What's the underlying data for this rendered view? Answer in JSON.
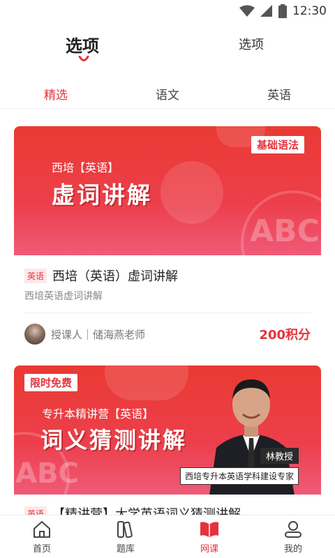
{
  "status_bar": {
    "time": "12:30"
  },
  "top_tabs": [
    {
      "label": "选项",
      "active": true
    },
    {
      "label": "选项",
      "active": false
    }
  ],
  "category_tabs": [
    {
      "label": "精选",
      "active": true
    },
    {
      "label": "语文",
      "active": false
    },
    {
      "label": "英语",
      "active": false
    }
  ],
  "courses": [
    {
      "banner": {
        "tag": "基础语法",
        "subtitle": "西培【英语】",
        "title": "虚词讲解",
        "watermark": "ABC"
      },
      "subject": "英语",
      "title": "西培（英语）虚词讲解",
      "description": "西培英语虚词讲解",
      "teacher": "授课人｜储海燕老师",
      "price": "200积分"
    },
    {
      "banner": {
        "tag": "限时免费",
        "subtitle": "专升本精讲营【英语】",
        "title": "词义猜测讲解",
        "watermark": "ABC",
        "person_name": "林教授",
        "person_caption": "西培专升本英语学科建设专家"
      },
      "subject": "英语",
      "title": "【精讲营】大学英语词义猜测讲解"
    }
  ],
  "bottom_nav": [
    {
      "label": "首页",
      "icon": "home-icon",
      "active": false
    },
    {
      "label": "题库",
      "icon": "question-bank-icon",
      "active": false
    },
    {
      "label": "网课",
      "icon": "open-book-icon",
      "active": true
    },
    {
      "label": "我的",
      "icon": "user-icon",
      "active": false
    }
  ],
  "colors": {
    "accent": "#e3343c",
    "banner_red": "#ea3a33"
  }
}
